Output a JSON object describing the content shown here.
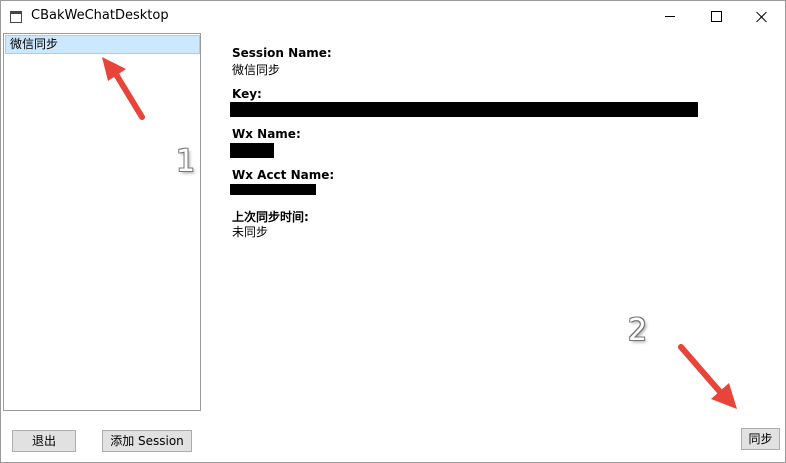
{
  "window": {
    "title": "CBakWeChatDesktop"
  },
  "sessions": [
    {
      "label": "微信同步"
    }
  ],
  "details": {
    "session_name_label": "Session Name:",
    "session_name_value": "微信同步",
    "key_label": "Key:",
    "wx_name_label": "Wx Name:",
    "wx_acct_name_label": "Wx Acct Name:",
    "last_sync_label": "上次同步时间:",
    "last_sync_value": "未同步"
  },
  "buttons": {
    "exit": "退出",
    "add_session": "添加 Session",
    "sync": "同步"
  },
  "annotations": {
    "step1": "1",
    "step2": "2",
    "arrow_color": "#e8443a"
  },
  "colors": {
    "selection": "#cce8ff",
    "redaction": "#000000"
  }
}
